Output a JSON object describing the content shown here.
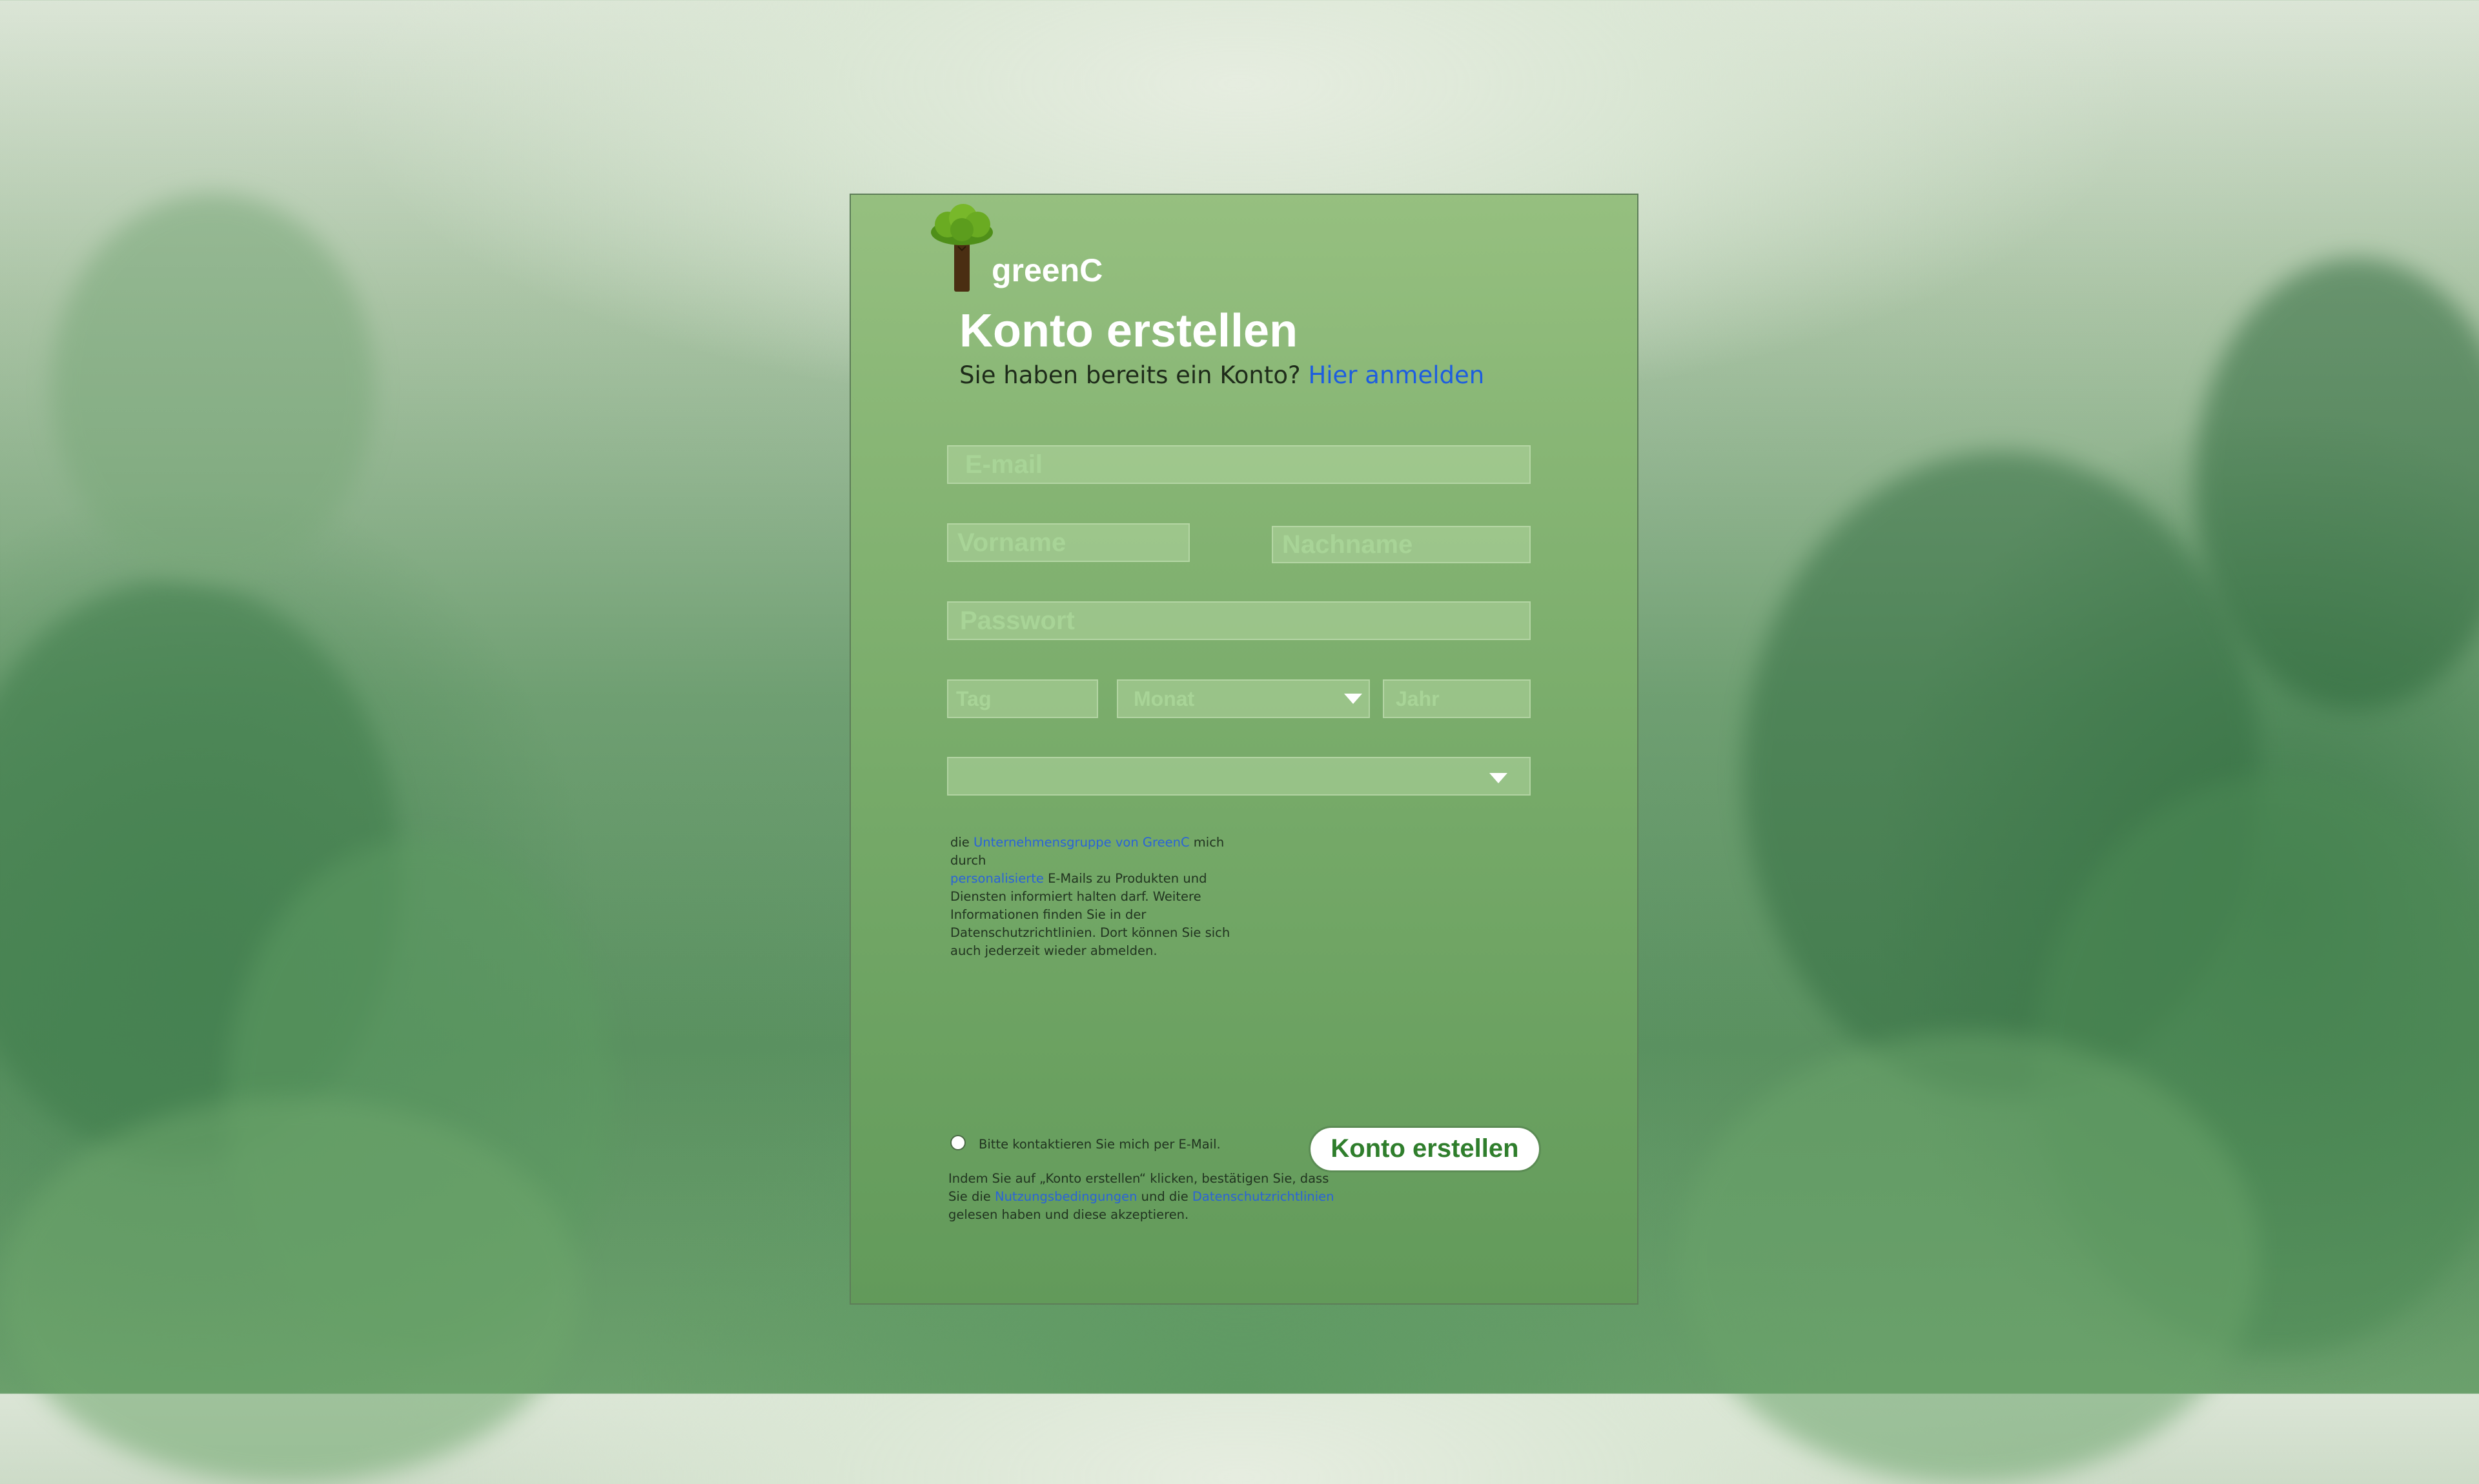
{
  "brand": {
    "name": "greenC"
  },
  "header": {
    "title": "Konto erstellen",
    "subtitle_text": "Sie haben bereits ein Konto?",
    "login_link": "Hier anmelden"
  },
  "form": {
    "email_placeholder": "E-mail",
    "firstname_placeholder": "Vorname",
    "lastname_placeholder": "Nachname",
    "password_placeholder": "Passwort",
    "day_placeholder": "Tag",
    "month_placeholder": "Monat",
    "year_placeholder": "Jahr",
    "gender_value": ""
  },
  "consent": {
    "t1": "die ",
    "link1": "Unternehmensgruppe von GreenC",
    "t2": " mich durch",
    "link2": "personalisierte",
    "t3": " E-Mails zu Produkten und Diensten informiert halten darf. Weitere Informationen finden Sie in der Datenschutzrichtlinien. Dort können Sie sich auch jederzeit wieder abmelden.",
    "radio_label": "Bitte kontaktieren Sie mich per E-Mail."
  },
  "terms": {
    "t1": "Indem Sie auf „Konto erstellen“ klicken, bestätigen Sie, dass Sie die ",
    "link1": "Nutzungsbedingungen",
    "t2": " und die ",
    "link2": "Datenschutzrichtlinien",
    "t3": " gelesen haben und diese akzeptieren."
  },
  "submit_label": "Konto erstellen",
  "colors": {
    "accent_link": "#1d5de0",
    "button_text": "#2f7e2c",
    "card": "#8fbe7c"
  },
  "icons": {
    "logo": "tree-logo-icon",
    "dropdown": "chevron-down-icon"
  }
}
